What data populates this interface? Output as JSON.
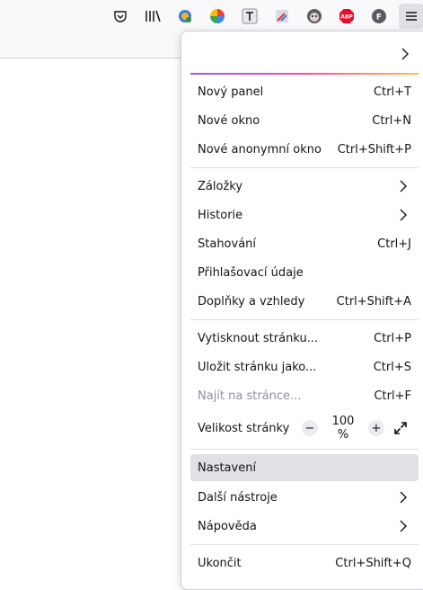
{
  "toolbar": {
    "icons": [
      "pocket-icon",
      "library-icon",
      "extension-globe-icon",
      "pinwheel-extension-icon",
      "text-extension-icon",
      "paint-extension-icon",
      "tampermonkey-icon",
      "adblock-icon",
      "profile-icon"
    ],
    "abp_text": "ABP",
    "profile_letter": "F"
  },
  "menu": {
    "new_tab": {
      "label": "Nový panel",
      "shortcut": "Ctrl+T"
    },
    "new_window": {
      "label": "Nové okno",
      "shortcut": "Ctrl+N"
    },
    "new_private": {
      "label": "Nové anonymní okno",
      "shortcut": "Ctrl+Shift+P"
    },
    "bookmarks": {
      "label": "Záložky"
    },
    "history": {
      "label": "Historie"
    },
    "downloads": {
      "label": "Stahování",
      "shortcut": "Ctrl+J"
    },
    "passwords": {
      "label": "Přihlašovací údaje"
    },
    "addons": {
      "label": "Doplňky a vzhledy",
      "shortcut": "Ctrl+Shift+A"
    },
    "print": {
      "label": "Vytisknout stránku...",
      "shortcut": "Ctrl+P"
    },
    "save": {
      "label": "Uložit stránku jako...",
      "shortcut": "Ctrl+S"
    },
    "find": {
      "label": "Najít na stránce...",
      "shortcut": "Ctrl+F"
    },
    "zoom": {
      "label": "Velikost stránky",
      "minus": "−",
      "value": "100 %",
      "plus": "+"
    },
    "settings": {
      "label": "Nastavení"
    },
    "more_tools": {
      "label": "Další nástroje"
    },
    "help": {
      "label": "Nápověda"
    },
    "exit": {
      "label": "Ukončit",
      "shortcut": "Ctrl+Shift+Q"
    }
  }
}
